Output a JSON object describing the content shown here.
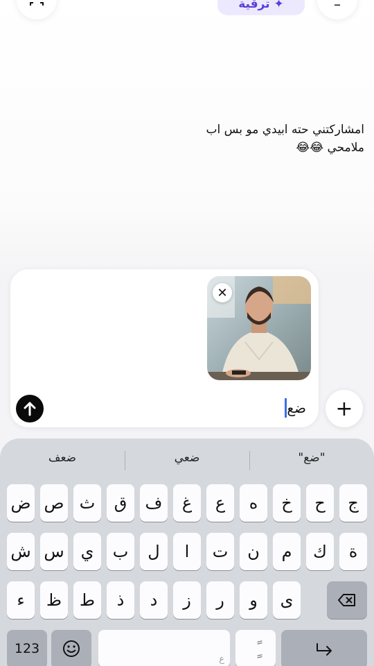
{
  "top": {
    "upgrade_label": "ترقية"
  },
  "message": {
    "line1": "امشاركتني حته ابيدي مو بس اب",
    "line2": "ملامحي 😂😂"
  },
  "composer": {
    "input_value": "ضع"
  },
  "keyboard": {
    "suggestions": [
      "\"ضع\"",
      "ضعي",
      "ضعف"
    ],
    "row1": [
      "ض",
      "ص",
      "ث",
      "ق",
      "ف",
      "غ",
      "ع",
      "ه",
      "خ",
      "ح",
      "ج"
    ],
    "row2": [
      "ش",
      "س",
      "ي",
      "ب",
      "ل",
      "ا",
      "ت",
      "ن",
      "م",
      "ك",
      "ة"
    ],
    "row3": [
      "ء",
      "ظ",
      "ط",
      "ذ",
      "د",
      "ز",
      "ر",
      "و",
      "ى"
    ],
    "numbers_label": "123",
    "space_hint": "ع",
    "diacritic_key": "ًٍ"
  }
}
